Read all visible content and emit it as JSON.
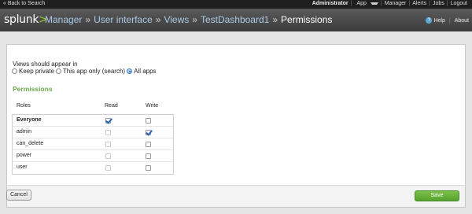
{
  "topbar": {
    "back_link": "« Back to Search",
    "user": "Administrator",
    "app_menu": "App",
    "manager": "Manager",
    "alerts": "Alerts",
    "jobs": "Jobs",
    "logout": "Logout"
  },
  "header": {
    "logo_text": "splunk",
    "logo_suffix": ">",
    "breadcrumbs": [
      "Manager",
      "User interface",
      "Views",
      "TestDashboard1"
    ],
    "crumb_sep": "»",
    "current": "Permissions",
    "help": "Help",
    "about": "About"
  },
  "views": {
    "label": "Views should appear in",
    "options": [
      {
        "label": "Keep private",
        "selected": false
      },
      {
        "label": "This app only (search)",
        "selected": false
      },
      {
        "label": "All apps",
        "selected": true
      }
    ]
  },
  "permissions": {
    "title": "Permissions",
    "columns": [
      "Roles",
      "Read",
      "Write"
    ],
    "rows": [
      {
        "role": "Everyone",
        "read": true,
        "write": false,
        "read_enabled": true
      },
      {
        "role": "admin",
        "read": false,
        "write": true,
        "read_enabled": false
      },
      {
        "role": "can_delete",
        "read": false,
        "write": false,
        "read_enabled": false
      },
      {
        "role": "power",
        "read": false,
        "write": false,
        "read_enabled": false
      },
      {
        "role": "user",
        "read": false,
        "write": false,
        "read_enabled": false
      }
    ]
  },
  "actions": {
    "cancel": "Cancel",
    "save": "Save"
  },
  "colors": {
    "accent_green": "#6aa84f",
    "save_button": "#56a22e",
    "breadcrumb_link": "#aac9e6"
  }
}
